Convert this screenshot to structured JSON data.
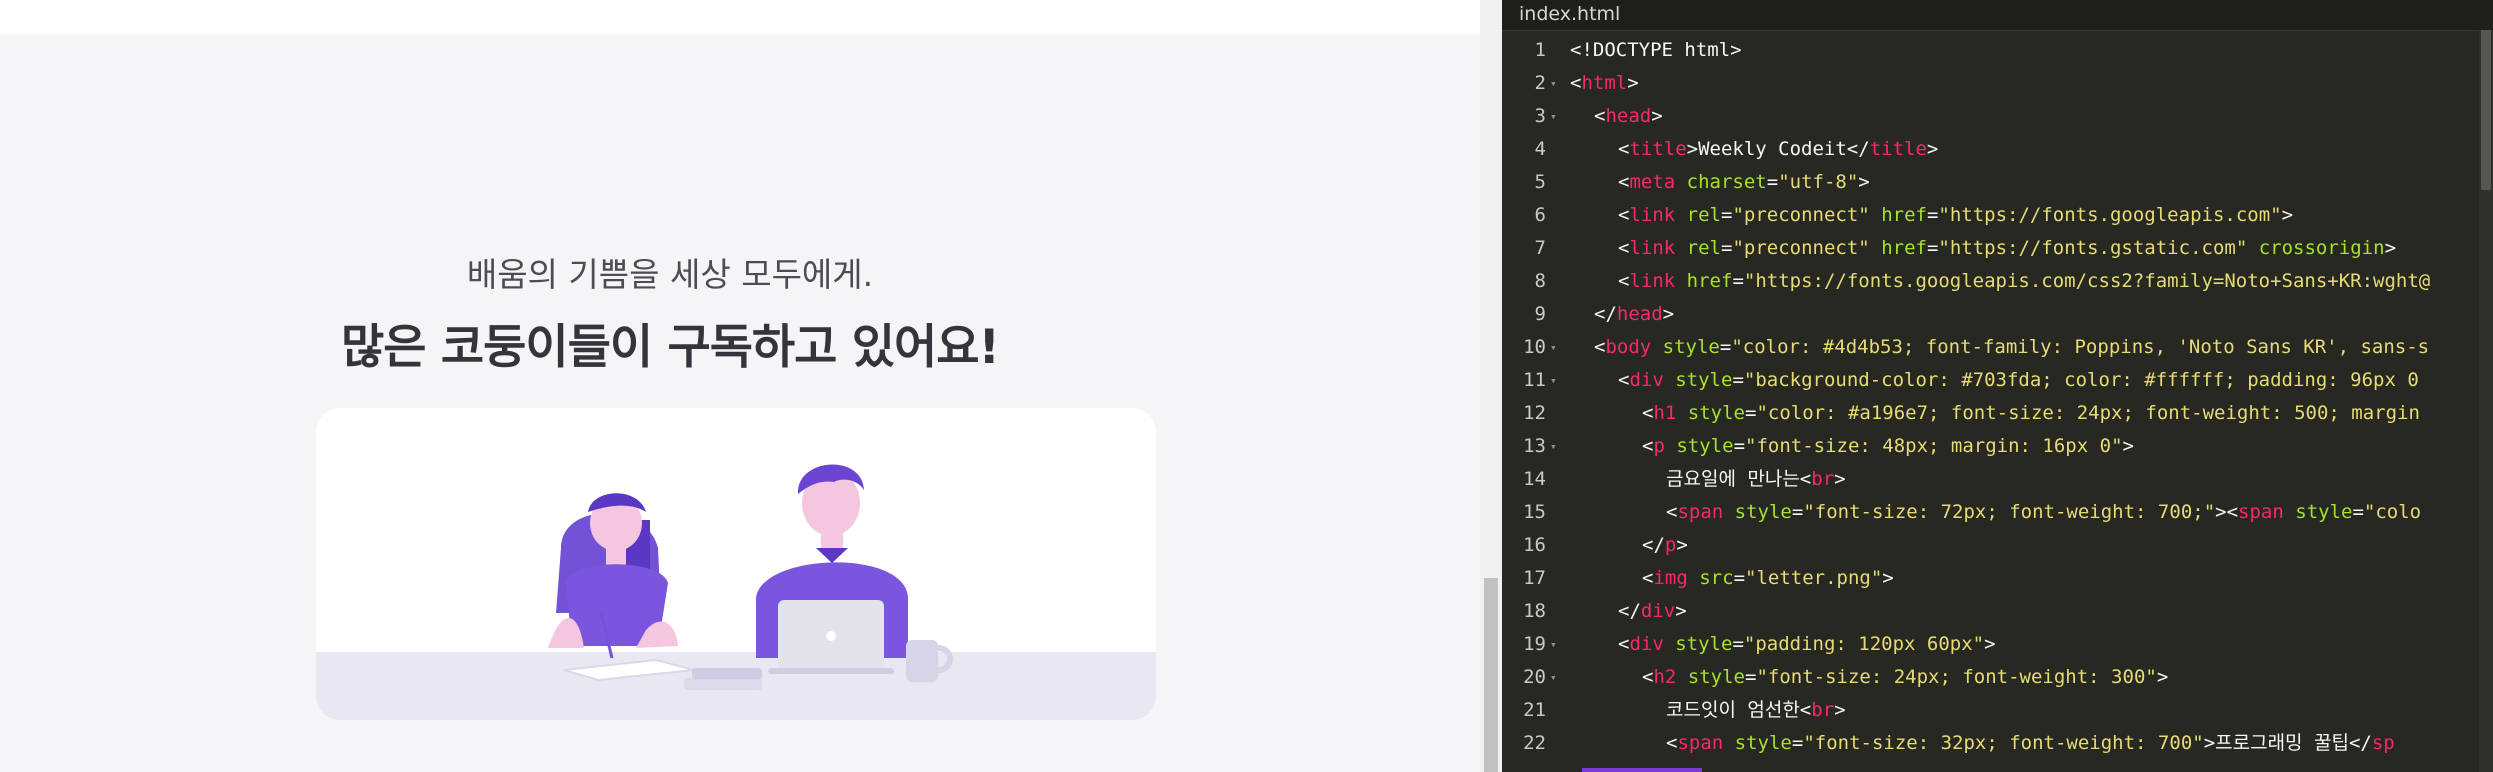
{
  "preview": {
    "subtitle": "배움의 기쁨을 세상 모두에게.",
    "headline": "많은 코둥이들이 구독하고 있어요!",
    "illustration_icon": "students-studying-illustration",
    "colors": {
      "accent": "#703fda",
      "text": "#4d4b53",
      "background": "#f5f5f7"
    }
  },
  "editor": {
    "filename": "index.html",
    "lines": [
      {
        "n": "1",
        "fold": "",
        "indent": 0,
        "code": [
          [
            "p",
            "<!DOCTYPE html>"
          ]
        ]
      },
      {
        "n": "2",
        "fold": "▾",
        "indent": 0,
        "code": [
          [
            "p",
            "<"
          ],
          [
            "t",
            "html"
          ],
          [
            "p",
            ">"
          ]
        ]
      },
      {
        "n": "3",
        "fold": "▾",
        "indent": 1,
        "code": [
          [
            "p",
            "<"
          ],
          [
            "t",
            "head"
          ],
          [
            "p",
            ">"
          ]
        ]
      },
      {
        "n": "4",
        "fold": "",
        "indent": 2,
        "code": [
          [
            "p",
            "<"
          ],
          [
            "t",
            "title"
          ],
          [
            "p",
            ">Weekly Codeit</"
          ],
          [
            "t",
            "title"
          ],
          [
            "p",
            ">"
          ]
        ]
      },
      {
        "n": "5",
        "fold": "",
        "indent": 2,
        "code": [
          [
            "p",
            "<"
          ],
          [
            "t",
            "meta"
          ],
          [
            "p",
            " "
          ],
          [
            "a",
            "charset"
          ],
          [
            "p",
            "="
          ],
          [
            "s",
            "\"utf-8\""
          ],
          [
            "p",
            ">"
          ]
        ]
      },
      {
        "n": "6",
        "fold": "",
        "indent": 2,
        "code": [
          [
            "p",
            "<"
          ],
          [
            "t",
            "link"
          ],
          [
            "p",
            " "
          ],
          [
            "a",
            "rel"
          ],
          [
            "p",
            "="
          ],
          [
            "s",
            "\"preconnect\""
          ],
          [
            "p",
            " "
          ],
          [
            "a",
            "href"
          ],
          [
            "p",
            "="
          ],
          [
            "s",
            "\"https://fonts.googleapis.com\""
          ],
          [
            "p",
            ">"
          ]
        ]
      },
      {
        "n": "7",
        "fold": "",
        "indent": 2,
        "code": [
          [
            "p",
            "<"
          ],
          [
            "t",
            "link"
          ],
          [
            "p",
            " "
          ],
          [
            "a",
            "rel"
          ],
          [
            "p",
            "="
          ],
          [
            "s",
            "\"preconnect\""
          ],
          [
            "p",
            " "
          ],
          [
            "a",
            "href"
          ],
          [
            "p",
            "="
          ],
          [
            "s",
            "\"https://fonts.gstatic.com\""
          ],
          [
            "p",
            " "
          ],
          [
            "a",
            "crossorigin"
          ],
          [
            "p",
            ">"
          ]
        ]
      },
      {
        "n": "8",
        "fold": "",
        "indent": 2,
        "code": [
          [
            "p",
            "<"
          ],
          [
            "t",
            "link"
          ],
          [
            "p",
            " "
          ],
          [
            "a",
            "href"
          ],
          [
            "p",
            "="
          ],
          [
            "s",
            "\"https://fonts.googleapis.com/css2?family=Noto+Sans+KR:wght@"
          ]
        ]
      },
      {
        "n": "9",
        "fold": "",
        "indent": 1,
        "code": [
          [
            "p",
            "</"
          ],
          [
            "t",
            "head"
          ],
          [
            "p",
            ">"
          ]
        ]
      },
      {
        "n": "10",
        "fold": "▾",
        "indent": 1,
        "code": [
          [
            "p",
            "<"
          ],
          [
            "t",
            "body"
          ],
          [
            "p",
            " "
          ],
          [
            "a",
            "style"
          ],
          [
            "p",
            "="
          ],
          [
            "s",
            "\"color: #4d4b53; font-family: Poppins, 'Noto Sans KR', sans-s"
          ]
        ]
      },
      {
        "n": "11",
        "fold": "▾",
        "indent": 2,
        "code": [
          [
            "p",
            "<"
          ],
          [
            "t",
            "div"
          ],
          [
            "p",
            " "
          ],
          [
            "a",
            "style"
          ],
          [
            "p",
            "="
          ],
          [
            "s",
            "\"background-color: #703fda; color: #ffffff; padding: 96px 0"
          ]
        ]
      },
      {
        "n": "12",
        "fold": "",
        "indent": 3,
        "code": [
          [
            "p",
            "<"
          ],
          [
            "t",
            "h1"
          ],
          [
            "p",
            " "
          ],
          [
            "a",
            "style"
          ],
          [
            "p",
            "="
          ],
          [
            "s",
            "\"color: #a196e7; font-size: 24px; font-weight: 500; margin"
          ]
        ]
      },
      {
        "n": "13",
        "fold": "▾",
        "indent": 3,
        "code": [
          [
            "p",
            "<"
          ],
          [
            "t",
            "p"
          ],
          [
            "p",
            " "
          ],
          [
            "a",
            "style"
          ],
          [
            "p",
            "="
          ],
          [
            "s",
            "\"font-size: 48px; margin: 16px 0\""
          ],
          [
            "p",
            ">"
          ]
        ]
      },
      {
        "n": "14",
        "fold": "",
        "indent": 4,
        "code": [
          [
            "p",
            "금요일에 만나는<"
          ],
          [
            "t",
            "br"
          ],
          [
            "p",
            ">"
          ]
        ]
      },
      {
        "n": "15",
        "fold": "",
        "indent": 4,
        "code": [
          [
            "p",
            "<"
          ],
          [
            "t",
            "span"
          ],
          [
            "p",
            " "
          ],
          [
            "a",
            "style"
          ],
          [
            "p",
            "="
          ],
          [
            "s",
            "\"font-size: 72px; font-weight: 700;\""
          ],
          [
            "p",
            "><"
          ],
          [
            "t",
            "span"
          ],
          [
            "p",
            " "
          ],
          [
            "a",
            "style"
          ],
          [
            "p",
            "="
          ],
          [
            "s",
            "\"colo"
          ]
        ]
      },
      {
        "n": "16",
        "fold": "",
        "indent": 3,
        "code": [
          [
            "p",
            "</"
          ],
          [
            "t",
            "p"
          ],
          [
            "p",
            ">"
          ]
        ]
      },
      {
        "n": "17",
        "fold": "",
        "indent": 3,
        "code": [
          [
            "p",
            "<"
          ],
          [
            "t",
            "img"
          ],
          [
            "p",
            " "
          ],
          [
            "a",
            "src"
          ],
          [
            "p",
            "="
          ],
          [
            "s",
            "\"letter.png\""
          ],
          [
            "p",
            ">"
          ]
        ]
      },
      {
        "n": "18",
        "fold": "",
        "indent": 2,
        "code": [
          [
            "p",
            "</"
          ],
          [
            "t",
            "div"
          ],
          [
            "p",
            ">"
          ]
        ]
      },
      {
        "n": "19",
        "fold": "▾",
        "indent": 2,
        "code": [
          [
            "p",
            "<"
          ],
          [
            "t",
            "div"
          ],
          [
            "p",
            " "
          ],
          [
            "a",
            "style"
          ],
          [
            "p",
            "="
          ],
          [
            "s",
            "\"padding: 120px 60px\""
          ],
          [
            "p",
            ">"
          ]
        ]
      },
      {
        "n": "20",
        "fold": "▾",
        "indent": 3,
        "code": [
          [
            "p",
            "<"
          ],
          [
            "t",
            "h2"
          ],
          [
            "p",
            " "
          ],
          [
            "a",
            "style"
          ],
          [
            "p",
            "="
          ],
          [
            "s",
            "\"font-size: 24px; font-weight: 300\""
          ],
          [
            "p",
            ">"
          ]
        ]
      },
      {
        "n": "21",
        "fold": "",
        "indent": 4,
        "code": [
          [
            "p",
            "코드잇이 엄선한<"
          ],
          [
            "t",
            "br"
          ],
          [
            "p",
            ">"
          ]
        ]
      },
      {
        "n": "22",
        "fold": "",
        "indent": 4,
        "code": [
          [
            "p",
            "<"
          ],
          [
            "t",
            "span"
          ],
          [
            "p",
            " "
          ],
          [
            "a",
            "style"
          ],
          [
            "p",
            "="
          ],
          [
            "s",
            "\"font-size: 32px; font-weight: 700\""
          ],
          [
            "p",
            ">프로그래밍 꿀팁</"
          ],
          [
            "t",
            "sp"
          ]
        ]
      }
    ],
    "colors": {
      "background": "#272822",
      "tag": "#f92672",
      "attr": "#a6e22e",
      "string": "#e6db74",
      "text": "#f8f8f2"
    }
  }
}
